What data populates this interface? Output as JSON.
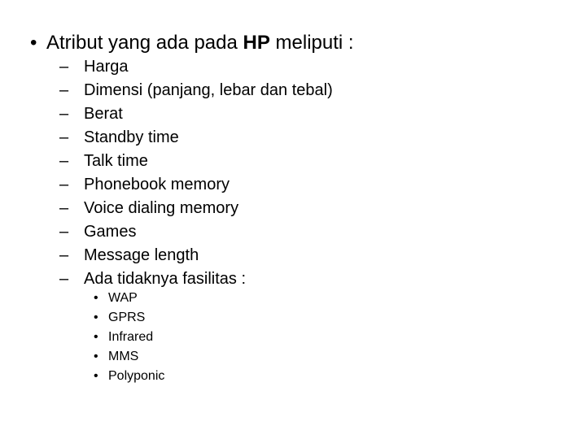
{
  "slide": {
    "title_item": {
      "marker": "•",
      "text_before": "Atribut yang ada pada ",
      "text_bold": "HP",
      "text_after": " meliputi :"
    },
    "level2_marker": "–",
    "level3_marker": "•",
    "items": [
      "Harga",
      "Dimensi (panjang, lebar dan tebal)",
      "Berat",
      "Standby time",
      "Talk time",
      "Phonebook memory",
      "Voice dialing memory",
      "Games",
      "Message length",
      "Ada tidaknya fasilitas :"
    ],
    "subitems": [
      "WAP",
      "GPRS",
      "Infrared",
      "MMS",
      "Polyponic"
    ]
  }
}
